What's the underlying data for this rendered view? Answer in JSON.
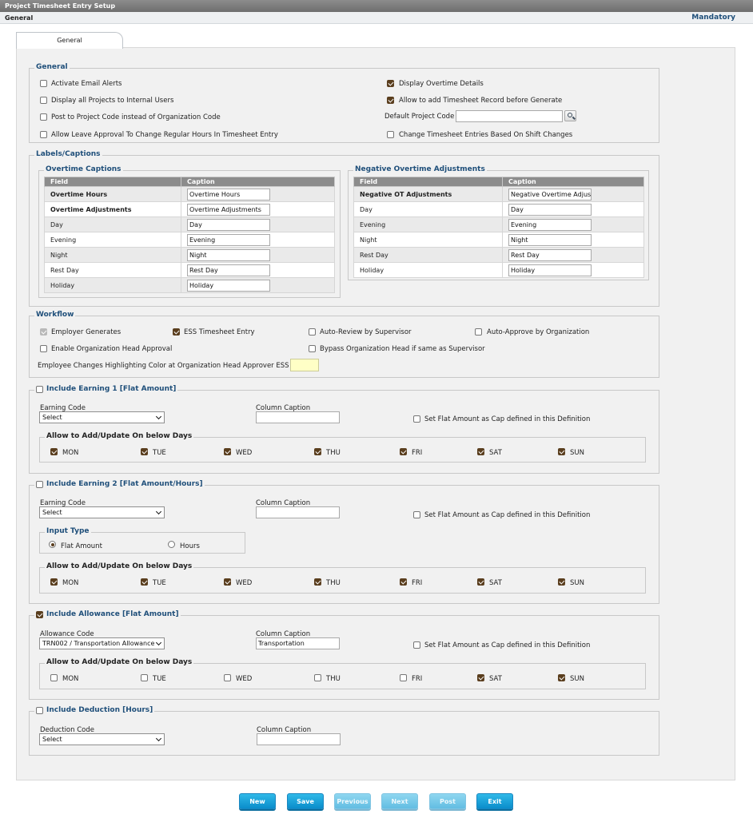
{
  "window": {
    "title": "Project Timesheet Entry Setup"
  },
  "subheader": {
    "left": "General",
    "mandatory": "Mandatory"
  },
  "tabs": [
    {
      "label": "General"
    }
  ],
  "general": {
    "title": "General",
    "activate_email_alerts": {
      "label": "Activate Email Alerts",
      "checked": false
    },
    "display_all_projects": {
      "label": "Display all Projects to Internal Users",
      "checked": false
    },
    "post_to_project_code": {
      "label": "Post to Project Code instead of Organization Code",
      "checked": false
    },
    "allow_leave_approval": {
      "label": "Allow Leave Approval To Change Regular Hours In Timesheet Entry",
      "checked": false
    },
    "display_overtime_details": {
      "label": "Display Overtime Details",
      "checked": true
    },
    "allow_add_timesheet": {
      "label": "Allow to add Timesheet Record before Generate",
      "checked": true
    },
    "default_project_code": {
      "label": "Default Project Code",
      "value": ""
    },
    "change_timesheet_entries": {
      "label": "Change Timesheet Entries Based On Shift Changes",
      "checked": false
    }
  },
  "labels": {
    "title": "Labels/Captions",
    "overtime": {
      "title": "Overtime Captions",
      "headers": [
        "Field",
        "Caption"
      ],
      "rows": [
        {
          "field": "Overtime Hours",
          "caption": "Overtime Hours"
        },
        {
          "field": "Overtime Adjustments",
          "caption": "Overtime Adjustments"
        },
        {
          "field": "Day",
          "caption": "Day"
        },
        {
          "field": "Evening",
          "caption": "Evening"
        },
        {
          "field": "Night",
          "caption": "Night"
        },
        {
          "field": "Rest Day",
          "caption": "Rest Day"
        },
        {
          "field": "Holiday",
          "caption": "Holiday"
        }
      ]
    },
    "negative": {
      "title": "Negative Overtime Adjustments",
      "headers": [
        "Field",
        "Caption"
      ],
      "rows": [
        {
          "field": "Negative OT Adjustments",
          "caption": "Negative Overtime Adjustme"
        },
        {
          "field": "Day",
          "caption": "Day"
        },
        {
          "field": "Evening",
          "caption": "Evening"
        },
        {
          "field": "Night",
          "caption": "Night"
        },
        {
          "field": "Rest Day",
          "caption": "Rest Day"
        },
        {
          "field": "Holiday",
          "caption": "Holiday"
        }
      ]
    }
  },
  "workflow": {
    "title": "Workflow",
    "employer_generates": {
      "label": "Employer Generates",
      "checked": true,
      "disabled": true
    },
    "ess_timesheet_entry": {
      "label": "ESS Timesheet Entry",
      "checked": true
    },
    "auto_review": {
      "label": "Auto-Review by Supervisor",
      "checked": false
    },
    "auto_approve": {
      "label": "Auto-Approve by Organization",
      "checked": false
    },
    "enable_org_head": {
      "label": "Enable Organization Head Approval",
      "checked": false
    },
    "bypass_org_head": {
      "label": "Bypass Organization Head if same as Supervisor",
      "checked": false
    },
    "highlight_color": {
      "label": "Employee Changes Highlighting Color at Organization Head Approver ESS Level",
      "color": "#ffffc6"
    }
  },
  "days_labels": [
    "MON",
    "TUE",
    "WED",
    "THU",
    "FRI",
    "SAT",
    "SUN"
  ],
  "earning1": {
    "title": "Include Earning 1 [Flat Amount]",
    "checked": false,
    "code_label": "Earning Code",
    "code_value": "Select",
    "caption_label": "Column Caption",
    "caption_value": "",
    "cap_label": "Set Flat Amount as Cap defined in this Definition",
    "cap_checked": false,
    "days_title": "Allow to Add/Update On below Days",
    "days": [
      true,
      true,
      true,
      true,
      true,
      true,
      true
    ]
  },
  "earning2": {
    "title": "Include Earning 2 [Flat Amount/Hours]",
    "checked": false,
    "code_label": "Earning Code",
    "code_value": "Select",
    "caption_label": "Column Caption",
    "caption_value": "",
    "cap_label": "Set Flat Amount as Cap defined in this Definition",
    "cap_checked": false,
    "input_type": {
      "title": "Input Type",
      "flat_amount": "Flat Amount",
      "hours": "Hours",
      "selected": "flat_amount"
    },
    "days_title": "Allow to Add/Update On below Days",
    "days": [
      true,
      true,
      true,
      true,
      true,
      true,
      true
    ]
  },
  "allowance": {
    "title": "Include Allowance [Flat Amount]",
    "checked": true,
    "code_label": "Allowance Code",
    "code_value": "TRN002 / Transportation Allowance",
    "caption_label": "Column Caption",
    "caption_value": "Transportation",
    "cap_label": "Set Flat Amount as Cap defined in this Definition",
    "cap_checked": false,
    "days_title": "Allow to Add/Update On below Days",
    "days": [
      false,
      false,
      false,
      false,
      false,
      true,
      true
    ]
  },
  "deduction": {
    "title": "Include Deduction [Hours]",
    "checked": false,
    "code_label": "Deduction Code",
    "code_value": "Select",
    "caption_label": "Column Caption",
    "caption_value": ""
  },
  "buttons": {
    "new": "New",
    "save": "Save",
    "previous": "Previous",
    "next": "Next",
    "post": "Post",
    "exit": "Exit"
  }
}
